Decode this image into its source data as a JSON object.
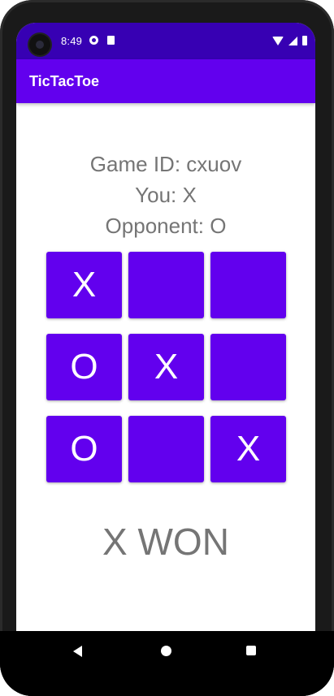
{
  "status_bar": {
    "time": "8:49"
  },
  "app_bar": {
    "title": "TicTacToe"
  },
  "game": {
    "game_id_text": "Game ID: cxuov",
    "you_text": "You: X",
    "opponent_text": "Opponent: O"
  },
  "board": {
    "cells": [
      "X",
      "",
      "",
      "O",
      "X",
      "",
      "O",
      "",
      "X"
    ]
  },
  "result_text": "X WON",
  "colors": {
    "status_bar": "#3700b3",
    "app_bar": "#6200ee",
    "cell": "#6200ee",
    "text_gray": "#757575"
  },
  "icons": {
    "status_left": [
      "camera-icon",
      "data-saver-icon",
      "sd-card-icon"
    ],
    "status_right": [
      "wifi-icon",
      "signal-icon",
      "battery-icon"
    ],
    "nav": [
      "back-icon",
      "home-icon",
      "recents-icon"
    ]
  }
}
